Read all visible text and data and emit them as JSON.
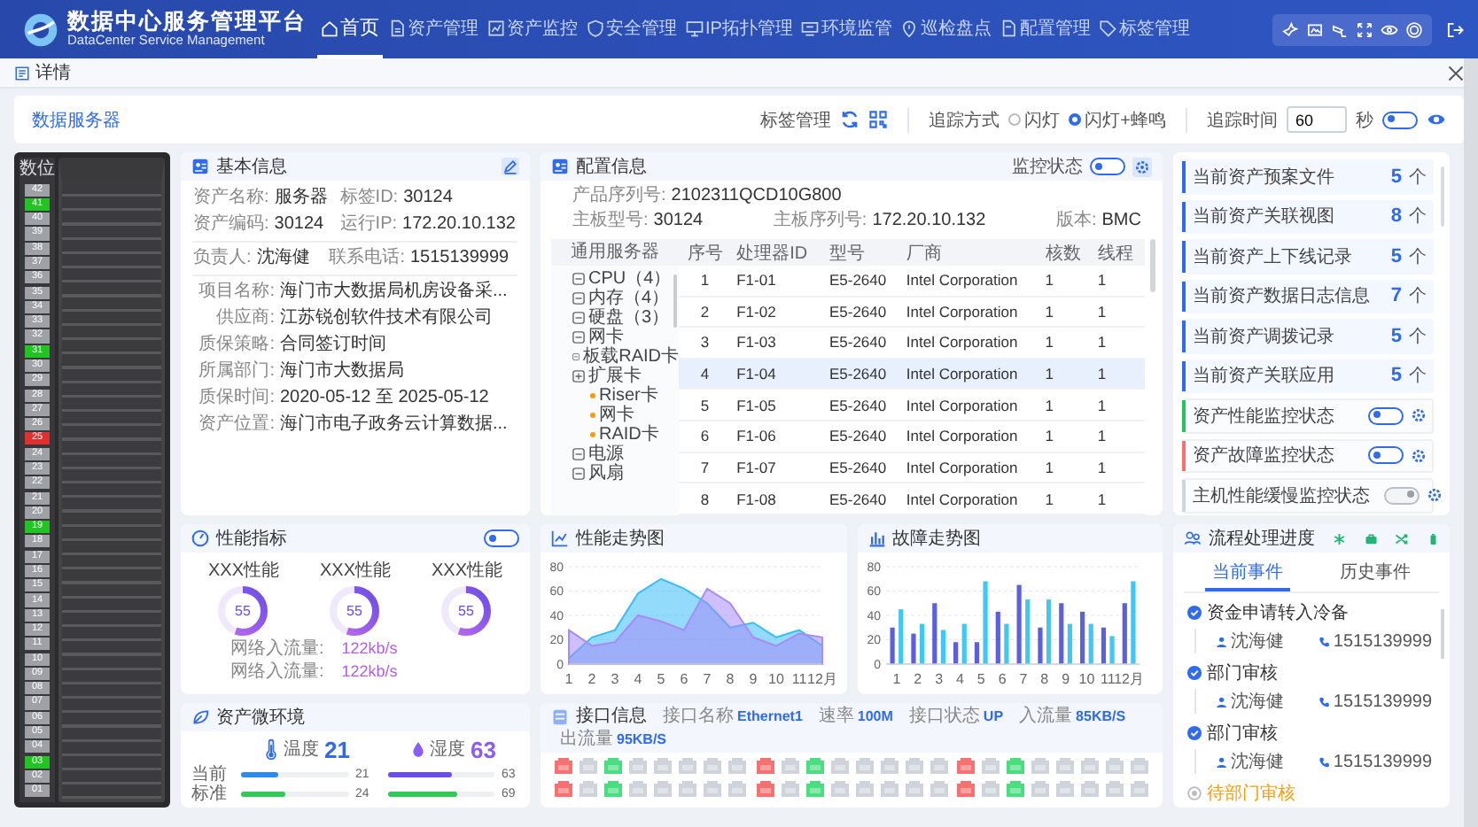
{
  "header": {
    "title": "数据中心服务管理平台",
    "subtitle": "DataCenter Service Management",
    "nav": [
      {
        "label": "首页",
        "selected": true
      },
      {
        "label": "资产管理",
        "selected": false
      },
      {
        "label": "资产监控",
        "selected": false
      },
      {
        "label": "安全管理",
        "selected": false
      },
      {
        "label": "IP拓扑管理",
        "selected": false
      },
      {
        "label": "环境监管",
        "selected": false
      },
      {
        "label": "巡检盘点",
        "selected": false
      },
      {
        "label": "配置管理",
        "selected": false
      },
      {
        "label": "标签管理",
        "selected": false
      }
    ]
  },
  "dialog": {
    "title": "详情"
  },
  "toolbar": {
    "device": "数据服务器",
    "tag_label": "标签管理",
    "trace_label": "追踪方式",
    "trace_options": [
      {
        "label": "闪灯",
        "selected": false
      },
      {
        "label": "闪灯+蜂鸣",
        "selected": true
      }
    ],
    "time_label": "追踪时间",
    "time_value": "60",
    "time_unit": "秒",
    "trace_on": true
  },
  "rack": {
    "title": "数位",
    "units": [
      {
        "label": "42",
        "color": "#9ea1a6"
      },
      {
        "label": "41",
        "color": "#22c322"
      },
      {
        "label": "40",
        "color": "#9ea1a6"
      },
      {
        "label": "39",
        "color": "#9ea1a6"
      },
      {
        "label": "38",
        "color": "#9ea1a6"
      },
      {
        "label": "37",
        "color": "#9ea1a6"
      },
      {
        "label": "36",
        "color": "#9ea1a6"
      },
      {
        "label": "35",
        "color": "#9ea1a6"
      },
      {
        "label": "34",
        "color": "#9ea1a6"
      },
      {
        "label": "33",
        "color": "#9ea1a6"
      },
      {
        "label": "32",
        "color": "#9ea1a6"
      },
      {
        "label": "31",
        "color": "#22c322"
      },
      {
        "label": "30",
        "color": "#9ea1a6"
      },
      {
        "label": "29",
        "color": "#9ea1a6"
      },
      {
        "label": "28",
        "color": "#9ea1a6"
      },
      {
        "label": "27",
        "color": "#9ea1a6"
      },
      {
        "label": "26",
        "color": "#9ea1a6"
      },
      {
        "label": "25",
        "color": "#e03131"
      },
      {
        "label": "24",
        "color": "#9ea1a6"
      },
      {
        "label": "23",
        "color": "#9ea1a6"
      },
      {
        "label": "22",
        "color": "#9ea1a6"
      },
      {
        "label": "21",
        "color": "#9ea1a6"
      },
      {
        "label": "20",
        "color": "#9ea1a6"
      },
      {
        "label": "19",
        "color": "#22c322"
      },
      {
        "label": "18",
        "color": "#9ea1a6"
      },
      {
        "label": "17",
        "color": "#9ea1a6"
      },
      {
        "label": "16",
        "color": "#9ea1a6"
      },
      {
        "label": "15",
        "color": "#9ea1a6"
      },
      {
        "label": "14",
        "color": "#9ea1a6"
      },
      {
        "label": "13",
        "color": "#9ea1a6"
      },
      {
        "label": "12",
        "color": "#9ea1a6"
      },
      {
        "label": "11",
        "color": "#9ea1a6"
      },
      {
        "label": "10",
        "color": "#9ea1a6"
      },
      {
        "label": "09",
        "color": "#9ea1a6"
      },
      {
        "label": "08",
        "color": "#9ea1a6"
      },
      {
        "label": "07",
        "color": "#9ea1a6"
      },
      {
        "label": "06",
        "color": "#9ea1a6"
      },
      {
        "label": "05",
        "color": "#9ea1a6"
      },
      {
        "label": "04",
        "color": "#9ea1a6"
      },
      {
        "label": "03",
        "color": "#22c322"
      },
      {
        "label": "02",
        "color": "#9ea1a6"
      },
      {
        "label": "01",
        "color": "#9ea1a6"
      }
    ]
  },
  "basic_info": {
    "title": "基本信息",
    "pairs": [
      [
        {
          "label": "资产名称:",
          "value": "服务器"
        },
        {
          "label": "标签ID:",
          "value": "30124"
        },
        {
          "label": "资产编码:",
          "value": "30124"
        },
        {
          "label": "运行IP:",
          "value": "172.20.10.132"
        }
      ],
      [
        {
          "label": "负责人:",
          "value": "沈海健"
        },
        {
          "label": "联系电话:",
          "value": "1515139999"
        }
      ]
    ],
    "fields": [
      {
        "label": "项目名称:",
        "value": "海门市大数据局机房设备采..."
      },
      {
        "label": "供应商:",
        "value": "江苏锐创软件技术有限公司"
      },
      {
        "label": "质保策略:",
        "value": "合同签订时间"
      },
      {
        "label": "所属部门:",
        "value": "海门市大数据局"
      },
      {
        "label": "质保时间:",
        "value": "2020-05-12 至 2025-05-12"
      },
      {
        "label": "资产位置:",
        "value": "海门市电子政务云计算数据..."
      }
    ]
  },
  "config": {
    "title": "配置信息",
    "monitor_label": "监控状态",
    "monitor_on": true,
    "serial": {
      "label": "产品序列号:",
      "value": "2102311QCD10G800"
    },
    "fields": [
      {
        "label": "主板型号:",
        "value": "30124"
      },
      {
        "label": "主板序列号:",
        "value": "172.20.10.132"
      },
      {
        "label": "版本:",
        "value": "BMC"
      }
    ],
    "tree_title": "通用服务器",
    "tree": [
      {
        "label": "CPU（4）",
        "expanded": false
      },
      {
        "label": "内存（4）",
        "expanded": false
      },
      {
        "label": "硬盘（3）",
        "expanded": false
      },
      {
        "label": "网卡",
        "expanded": false
      },
      {
        "label": "板载RAID卡",
        "expanded": false
      },
      {
        "label": "扩展卡",
        "expanded": true,
        "children": [
          {
            "label": "Riser卡"
          },
          {
            "label": "网卡"
          },
          {
            "label": "RAID卡"
          }
        ]
      },
      {
        "label": "电源",
        "expanded": false
      },
      {
        "label": "风扇",
        "expanded": false
      }
    ],
    "table": {
      "columns": [
        "序号",
        "处理器ID",
        "型号",
        "厂商",
        "核数",
        "线程"
      ],
      "rows": [
        {
          "cells": [
            "1",
            "F1-01",
            "E5-2640",
            "Intel Corporation",
            "1",
            "1"
          ],
          "selected": false
        },
        {
          "cells": [
            "2",
            "F1-02",
            "E5-2640",
            "Intel Corporation",
            "1",
            "1"
          ],
          "selected": false
        },
        {
          "cells": [
            "3",
            "F1-03",
            "E5-2640",
            "Intel Corporation",
            "1",
            "1"
          ],
          "selected": false
        },
        {
          "cells": [
            "4",
            "F1-04",
            "E5-2640",
            "Intel Corporation",
            "1",
            "1"
          ],
          "selected": true
        },
        {
          "cells": [
            "5",
            "F1-05",
            "E5-2640",
            "Intel Corporation",
            "1",
            "1"
          ],
          "selected": false
        },
        {
          "cells": [
            "6",
            "F1-06",
            "E5-2640",
            "Intel Corporation",
            "1",
            "1"
          ],
          "selected": false
        },
        {
          "cells": [
            "7",
            "F1-07",
            "E5-2640",
            "Intel Corporation",
            "1",
            "1"
          ],
          "selected": false
        },
        {
          "cells": [
            "8",
            "F1-08",
            "E5-2640",
            "Intel Corporation",
            "1",
            "1"
          ],
          "selected": false
        }
      ]
    }
  },
  "related": {
    "counts": [
      {
        "label": "当前资产预案文件",
        "count": "5",
        "unit": "个"
      },
      {
        "label": "当前资产关联视图",
        "count": "8",
        "unit": "个"
      },
      {
        "label": "当前资产上下线记录",
        "count": "5",
        "unit": "个"
      },
      {
        "label": "当前资产数据日志信息",
        "count": "7",
        "unit": "个"
      },
      {
        "label": "当前资产调拨记录",
        "count": "5",
        "unit": "个"
      },
      {
        "label": "当前资产关联应用",
        "count": "5",
        "unit": "个"
      }
    ],
    "monitors": [
      {
        "label": "资产性能监控状态",
        "color": "#22c55e",
        "on": true
      },
      {
        "label": "资产故障监控状态",
        "color": "#f87171",
        "on": true
      },
      {
        "label": "主机性能缓慢监控状态",
        "color": "#cbd5e1",
        "on": false
      }
    ]
  },
  "performance": {
    "title": "性能指标",
    "on": true,
    "gauges": [
      {
        "label": "XXX性能",
        "value": "55",
        "level": 0.55
      },
      {
        "label": "XXX性能",
        "value": "55",
        "level": 0.55
      },
      {
        "label": "XXX性能",
        "value": "55",
        "level": 0.55
      }
    ],
    "traffic": [
      {
        "label": "网络入流量:",
        "value": "122kb/s"
      },
      {
        "label": "网络入流量:",
        "value": "122kb/s"
      }
    ]
  },
  "perf_trend": {
    "title": "性能走势图",
    "chart_data": {
      "type": "area",
      "grid": true,
      "categories": [
        "1",
        "2",
        "3",
        "4",
        "5",
        "6",
        "7",
        "8",
        "9",
        "10",
        "11",
        "12月"
      ],
      "ylim": [
        0,
        80
      ],
      "yticks": [
        0,
        20,
        40,
        60,
        80
      ],
      "series": [
        {
          "color": "#38bdf8",
          "values": [
            5,
            22,
            28,
            58,
            70,
            62,
            50,
            30,
            34,
            22,
            28,
            15
          ]
        },
        {
          "color": "#a78bfa",
          "values": [
            28,
            15,
            18,
            40,
            35,
            28,
            62,
            50,
            22,
            15,
            25,
            22
          ]
        }
      ]
    }
  },
  "fault_trend": {
    "title": "故障走势图",
    "chart_data": {
      "type": "bar",
      "grid": true,
      "categories": [
        "1",
        "2",
        "3",
        "4",
        "5",
        "6",
        "7",
        "8",
        "9",
        "10",
        "11",
        "12月"
      ],
      "ylim": [
        0,
        80
      ],
      "yticks": [
        0,
        20,
        40,
        60,
        80
      ],
      "series": [
        {
          "color": "#5b5fe0",
          "values": [
            30,
            25,
            50,
            18,
            18,
            43,
            65,
            30,
            50,
            43,
            30,
            50
          ]
        },
        {
          "color": "#3fc8f5",
          "values": [
            45,
            33,
            28,
            33,
            68,
            33,
            53,
            53,
            33,
            33,
            23,
            68
          ]
        }
      ]
    }
  },
  "environment": {
    "title": "资产微环境",
    "row_labels": [
      "当前",
      "标准"
    ],
    "sensors": [
      {
        "kind": "temperature",
        "label": "温度",
        "value": "21",
        "bars": [
          {
            "reading": "21",
            "level": 0.35
          },
          {
            "reading": "24",
            "level": 0.42
          }
        ]
      },
      {
        "kind": "humidity",
        "label": "湿度",
        "value": "63",
        "bars": [
          {
            "reading": "63",
            "level": 0.6
          },
          {
            "reading": "69",
            "level": 0.66
          }
        ]
      }
    ]
  },
  "interface": {
    "title": "接口信息",
    "stats": [
      {
        "label": "接口名称",
        "value": "Ethernet1"
      },
      {
        "label": "速率",
        "value": "100M"
      },
      {
        "label": "接口状态",
        "value": "UP"
      },
      {
        "label": "入流量",
        "value": "85KB/S"
      },
      {
        "label": "出流量",
        "value": "95KB/S"
      }
    ],
    "port_groups": [
      {
        "rows": [
          [
            {
              "color": "#f87171"
            },
            {
              "color": "#cfd4dc"
            },
            {
              "color": "#4ade80"
            },
            {
              "color": "#cfd4dc"
            },
            {
              "color": "#cfd4dc"
            },
            {
              "color": "#cfd4dc"
            },
            {
              "color": "#cfd4dc"
            },
            {
              "color": "#cfd4dc"
            }
          ],
          [
            {
              "color": "#f87171"
            },
            {
              "color": "#cfd4dc"
            },
            {
              "color": "#4ade80"
            },
            {
              "color": "#cfd4dc"
            },
            {
              "color": "#cfd4dc"
            },
            {
              "color": "#cfd4dc"
            },
            {
              "color": "#cfd4dc"
            },
            {
              "color": "#cfd4dc"
            }
          ]
        ]
      },
      {
        "rows": [
          [
            {
              "color": "#f87171"
            },
            {
              "color": "#cfd4dc"
            },
            {
              "color": "#4ade80"
            },
            {
              "color": "#cfd4dc"
            },
            {
              "color": "#cfd4dc"
            },
            {
              "color": "#cfd4dc"
            },
            {
              "color": "#cfd4dc"
            },
            {
              "color": "#cfd4dc"
            }
          ],
          [
            {
              "color": "#f87171"
            },
            {
              "color": "#cfd4dc"
            },
            {
              "color": "#4ade80"
            },
            {
              "color": "#cfd4dc"
            },
            {
              "color": "#cfd4dc"
            },
            {
              "color": "#cfd4dc"
            },
            {
              "color": "#cfd4dc"
            },
            {
              "color": "#cfd4dc"
            }
          ]
        ]
      },
      {
        "rows": [
          [
            {
              "color": "#f87171"
            },
            {
              "color": "#cfd4dc"
            },
            {
              "color": "#4ade80"
            },
            {
              "color": "#cfd4dc"
            },
            {
              "color": "#cfd4dc"
            },
            {
              "color": "#cfd4dc"
            },
            {
              "color": "#cfd4dc"
            },
            {
              "color": "#cfd4dc"
            }
          ],
          [
            {
              "color": "#f87171"
            },
            {
              "color": "#cfd4dc"
            },
            {
              "color": "#4ade80"
            },
            {
              "color": "#cfd4dc"
            },
            {
              "color": "#cfd4dc"
            },
            {
              "color": "#cfd4dc"
            },
            {
              "color": "#cfd4dc"
            },
            {
              "color": "#cfd4dc"
            }
          ]
        ]
      }
    ]
  },
  "flow": {
    "title": "流程处理进度",
    "tabs": [
      {
        "label": "当前事件",
        "selected": true
      },
      {
        "label": "历史事件",
        "selected": false
      }
    ],
    "steps": [
      {
        "title": "资金申请转入冷备",
        "done": true,
        "person": "沈海健",
        "phone": "1515139999"
      },
      {
        "title": "部门审核",
        "done": true,
        "person": "沈海健",
        "phone": "1515139999"
      },
      {
        "title": "部门审核",
        "done": true,
        "person": "沈海健",
        "phone": "1515139999"
      },
      {
        "title": "待部门审核",
        "done": false
      }
    ]
  }
}
